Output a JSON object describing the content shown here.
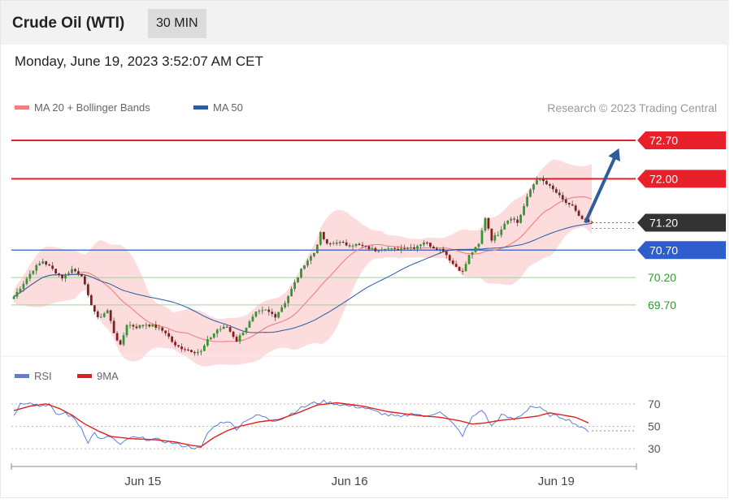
{
  "header": {
    "title": "Crude Oil (WTI)",
    "timeframe": "30 MIN"
  },
  "timestamp": "Monday, June 19, 2023 3:52:07 AM CET",
  "legend_top": [
    {
      "label": "MA 20 + Bollinger Bands",
      "color": "#f08080"
    },
    {
      "label": "MA 50",
      "color": "#2d5aa0"
    }
  ],
  "credit": "Research © 2023 Trading Central",
  "legend_rsi": [
    {
      "label": "RSI",
      "color": "#5b7fd6"
    },
    {
      "label": "9MA",
      "color": "#e02020"
    }
  ],
  "colors": {
    "resistance": "#e8202a",
    "pivot": "#2e5dcc",
    "support": "#2e9a2e",
    "last": "#333333",
    "band": "#fcd6d6",
    "arrow": "#2e5d9e",
    "candle_up": "#2e9a2e",
    "candle_down": "#8b1a1a"
  },
  "chart_data": [
    {
      "type": "candlestick",
      "title": "Crude Oil (WTI)",
      "ylim": [
        68.9,
        73.1
      ],
      "x_ticks": [
        {
          "label": "Jun 15",
          "index": 40
        },
        {
          "label": "Jun 16",
          "index": 104
        },
        {
          "label": "Jun 19",
          "index": 168
        }
      ],
      "n_bars": 180,
      "levels": [
        {
          "value": 72.7,
          "label": "72.70",
          "kind": "resistance"
        },
        {
          "value": 72.0,
          "label": "72.00",
          "kind": "resistance"
        },
        {
          "value": 71.2,
          "label": "71.20",
          "kind": "last"
        },
        {
          "value": 70.7,
          "label": "70.70",
          "kind": "pivot"
        },
        {
          "value": 70.2,
          "label": "70.20",
          "kind": "support"
        },
        {
          "value": 69.7,
          "label": "69.70",
          "kind": "support"
        }
      ],
      "close_anchors": [
        [
          0,
          69.85
        ],
        [
          3,
          70.1
        ],
        [
          6,
          70.35
        ],
        [
          9,
          70.5
        ],
        [
          12,
          70.35
        ],
        [
          15,
          70.2
        ],
        [
          18,
          70.35
        ],
        [
          21,
          70.25
        ],
        [
          23,
          69.85
        ],
        [
          26,
          69.45
        ],
        [
          29,
          69.6
        ],
        [
          31,
          69.2
        ],
        [
          33,
          68.95
        ],
        [
          35,
          69.35
        ],
        [
          38,
          69.3
        ],
        [
          41,
          69.35
        ],
        [
          44,
          69.3
        ],
        [
          47,
          69.2
        ],
        [
          50,
          68.95
        ],
        [
          53,
          68.9
        ],
        [
          56,
          68.85
        ],
        [
          58,
          68.85
        ],
        [
          60,
          69.05
        ],
        [
          63,
          69.25
        ],
        [
          66,
          69.3
        ],
        [
          69,
          69.05
        ],
        [
          72,
          69.3
        ],
        [
          75,
          69.55
        ],
        [
          78,
          69.6
        ],
        [
          81,
          69.5
        ],
        [
          84,
          69.75
        ],
        [
          87,
          70.1
        ],
        [
          90,
          70.45
        ],
        [
          93,
          70.65
        ],
        [
          95,
          71.0
        ],
        [
          97,
          70.8
        ],
        [
          100,
          70.85
        ],
        [
          103,
          70.8
        ],
        [
          106,
          70.8
        ],
        [
          109,
          70.75
        ],
        [
          112,
          70.7
        ],
        [
          115,
          70.75
        ],
        [
          118,
          70.7
        ],
        [
          121,
          70.75
        ],
        [
          124,
          70.75
        ],
        [
          127,
          70.85
        ],
        [
          130,
          70.75
        ],
        [
          133,
          70.7
        ],
        [
          136,
          70.45
        ],
        [
          139,
          70.3
        ],
        [
          141,
          70.6
        ],
        [
          144,
          70.8
        ],
        [
          146,
          71.3
        ],
        [
          148,
          70.9
        ],
        [
          150,
          71.0
        ],
        [
          152,
          71.2
        ],
        [
          154,
          71.3
        ],
        [
          156,
          71.2
        ],
        [
          158,
          71.5
        ],
        [
          160,
          71.8
        ],
        [
          162,
          72.0
        ],
        [
          164,
          71.95
        ],
        [
          166,
          71.85
        ],
        [
          168,
          71.75
        ],
        [
          170,
          71.6
        ],
        [
          173,
          71.5
        ],
        [
          175,
          71.3
        ],
        [
          178,
          71.2
        ]
      ],
      "annotations": [
        {
          "type": "arrow",
          "from_index": 177,
          "from_value": 71.2,
          "to_index": 187,
          "to_value": 72.5
        }
      ]
    },
    {
      "type": "line",
      "title": "RSI",
      "ylim": [
        25,
        80
      ],
      "y_ticks": [
        70,
        50,
        30
      ],
      "series": [
        {
          "name": "RSI",
          "anchors": [
            [
              0,
              60
            ],
            [
              2,
              70
            ],
            [
              5,
              72
            ],
            [
              8,
              68
            ],
            [
              11,
              70
            ],
            [
              13,
              60
            ],
            [
              16,
              62
            ],
            [
              19,
              56
            ],
            [
              21,
              48
            ],
            [
              23,
              36
            ],
            [
              25,
              44
            ],
            [
              27,
              38
            ],
            [
              30,
              41
            ],
            [
              33,
              33
            ],
            [
              36,
              40
            ],
            [
              40,
              39
            ],
            [
              44,
              38
            ],
            [
              48,
              36
            ],
            [
              52,
              33
            ],
            [
              56,
              31
            ],
            [
              58,
              30
            ],
            [
              60,
              44
            ],
            [
              63,
              52
            ],
            [
              66,
              55
            ],
            [
              69,
              48
            ],
            [
              72,
              56
            ],
            [
              76,
              60
            ],
            [
              80,
              55
            ],
            [
              84,
              58
            ],
            [
              88,
              65
            ],
            [
              92,
              70
            ],
            [
              96,
              72
            ],
            [
              100,
              70
            ],
            [
              104,
              68
            ],
            [
              108,
              67
            ],
            [
              112,
              63
            ],
            [
              116,
              60
            ],
            [
              120,
              58
            ],
            [
              124,
              62
            ],
            [
              128,
              58
            ],
            [
              132,
              64
            ],
            [
              136,
              52
            ],
            [
              139,
              42
            ],
            [
              142,
              58
            ],
            [
              145,
              65
            ],
            [
              148,
              50
            ],
            [
              151,
              60
            ],
            [
              155,
              56
            ],
            [
              158,
              62
            ],
            [
              160,
              68
            ],
            [
              163,
              66
            ],
            [
              166,
              60
            ],
            [
              170,
              58
            ],
            [
              173,
              54
            ],
            [
              176,
              48
            ],
            [
              178,
              46
            ]
          ]
        },
        {
          "name": "9MA",
          "anchors": [
            [
              0,
              64
            ],
            [
              5,
              68
            ],
            [
              10,
              70
            ],
            [
              14,
              66
            ],
            [
              18,
              60
            ],
            [
              22,
              52
            ],
            [
              26,
              46
            ],
            [
              30,
              41
            ],
            [
              36,
              39
            ],
            [
              44,
              38
            ],
            [
              50,
              36
            ],
            [
              55,
              33
            ],
            [
              58,
              32
            ],
            [
              62,
              40
            ],
            [
              66,
              46
            ],
            [
              70,
              50
            ],
            [
              76,
              54
            ],
            [
              82,
              56
            ],
            [
              88,
              62
            ],
            [
              94,
              69
            ],
            [
              100,
              71
            ],
            [
              108,
              68
            ],
            [
              116,
              63
            ],
            [
              124,
              60
            ],
            [
              132,
              58
            ],
            [
              138,
              55
            ],
            [
              142,
              52
            ],
            [
              146,
              53
            ],
            [
              150,
              55
            ],
            [
              156,
              57
            ],
            [
              162,
              59
            ],
            [
              166,
              62
            ],
            [
              170,
              60
            ],
            [
              174,
              58
            ],
            [
              178,
              53
            ]
          ]
        }
      ]
    }
  ]
}
